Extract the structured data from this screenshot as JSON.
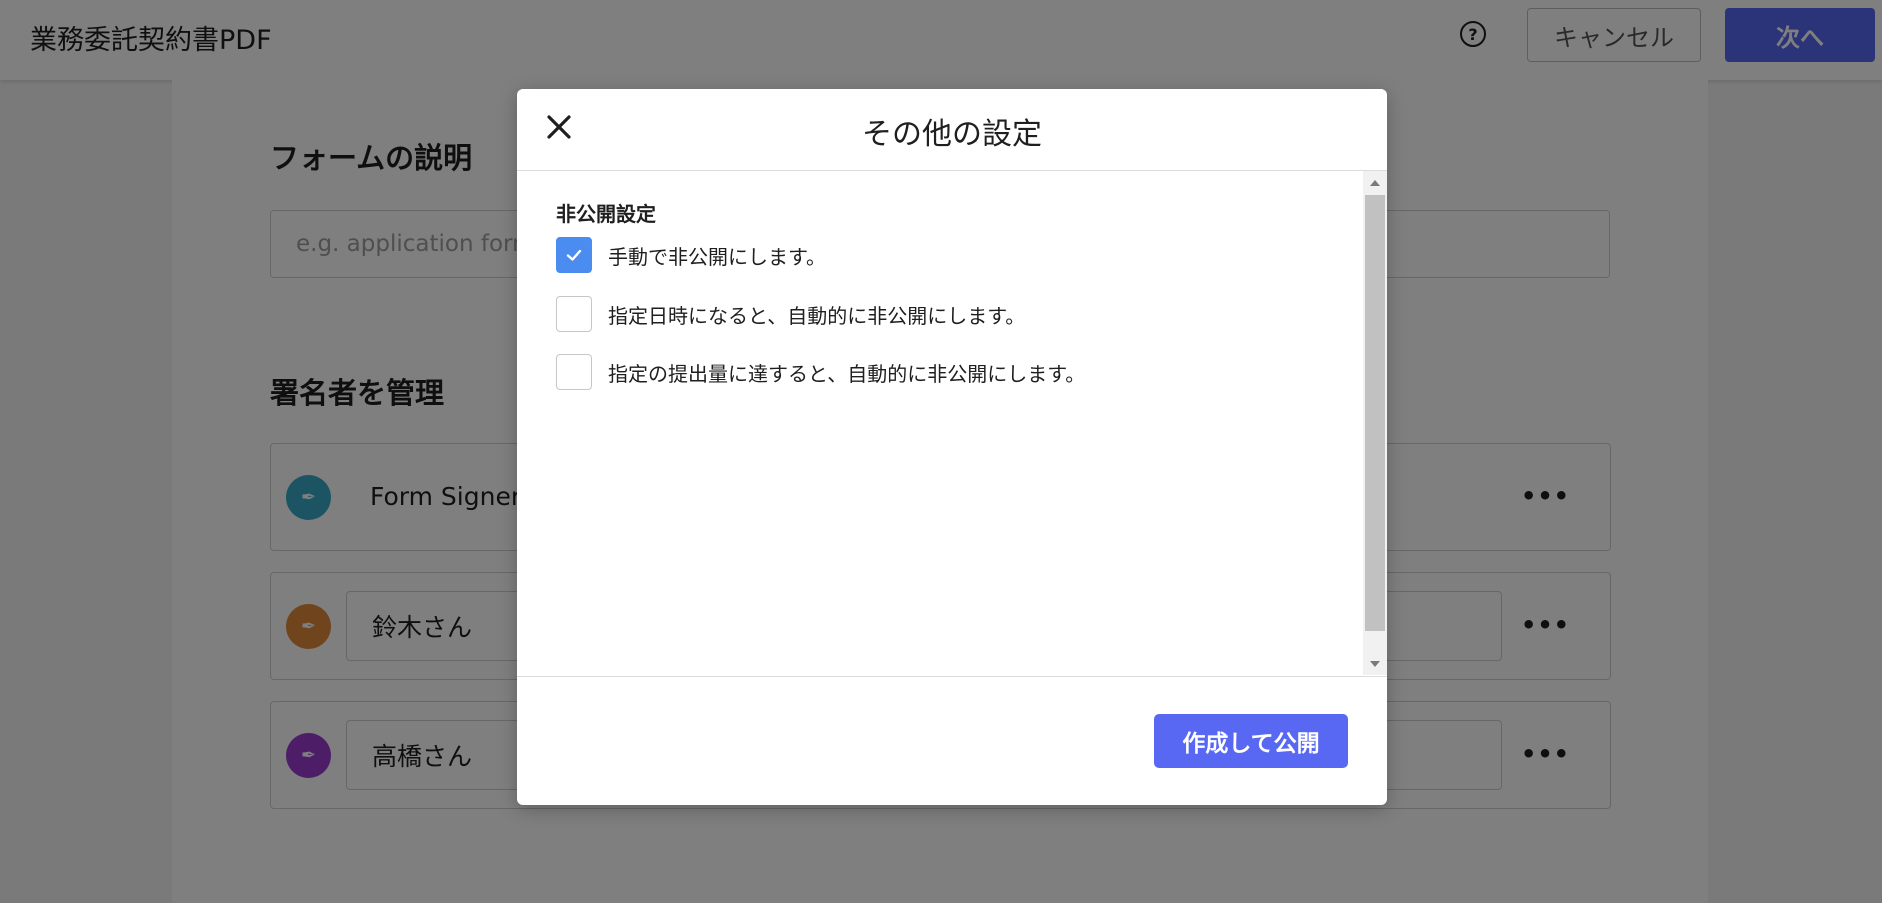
{
  "header": {
    "document_title": "業務委託契約書PDF",
    "help_icon": "question-circle-icon",
    "cancel_label": "キャンセル",
    "next_label": "次へ"
  },
  "main": {
    "form_description": {
      "heading": "フォームの説明",
      "placeholder": "e.g. application form"
    },
    "signers": {
      "heading": "署名者を管理",
      "items": [
        {
          "name": "Form Signer",
          "avatar_color": "#3aa9c6",
          "icon": "pen-nib-icon"
        },
        {
          "name": "鈴木さん",
          "avatar_color": "#e08a3c",
          "icon": "pen-nib-icon"
        },
        {
          "name": "高橋さん",
          "avatar_color": "#9b3ccf",
          "icon": "pen-nib-icon"
        }
      ]
    }
  },
  "modal": {
    "title": "その他の設定",
    "close_icon": "close-icon",
    "private_settings": {
      "label": "非公開設定",
      "options": [
        {
          "label": "手動で非公開にします。",
          "checked": true
        },
        {
          "label": "指定日時になると、自動的に非公開にします。",
          "checked": false
        },
        {
          "label": "指定の提出量に達すると、自動的に非公開にします。",
          "checked": false
        }
      ]
    },
    "publish_label": "作成して公開"
  },
  "colors": {
    "primary": "#5868f2",
    "checkbox_checked": "#4a8cf0"
  }
}
